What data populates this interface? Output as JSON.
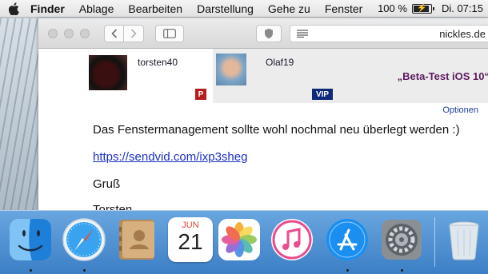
{
  "menubar": {
    "app_name": "Finder",
    "items": [
      "Ablage",
      "Bearbeiten",
      "Darstellung",
      "Gehe zu",
      "Fenster"
    ],
    "battery": "100 %",
    "clock": "Di. 07:15"
  },
  "browser": {
    "address_host": "nickles.de"
  },
  "post": {
    "author_name": "torsten40",
    "author_badge": "P",
    "quoted_name": "Olaf19",
    "quoted_badge": "VIP",
    "thread_title": "„Beta-Test iOS 10“",
    "options_label": "Optionen",
    "body": "Das Fenstermanagement sollte wohl nochmal neu überlegt werden :)",
    "link": "https://sendvid.com/ixp3sheg",
    "greeting": "Gruß",
    "signature": "Torsten"
  },
  "dock": {
    "calendar_month": "JUN",
    "calendar_day": "21",
    "icons": [
      "finder-icon",
      "safari-icon",
      "contacts-icon",
      "calendar-icon",
      "photos-icon",
      "itunes-icon",
      "app-store-icon",
      "system-preferences-icon",
      "trash-icon"
    ]
  },
  "colors": {
    "link": "#1a30c8",
    "thread_title": "#5d1a5f",
    "badge_p": "#b81c1c",
    "badge_vip": "#0d2a7a",
    "dock": "#4f93d6"
  }
}
